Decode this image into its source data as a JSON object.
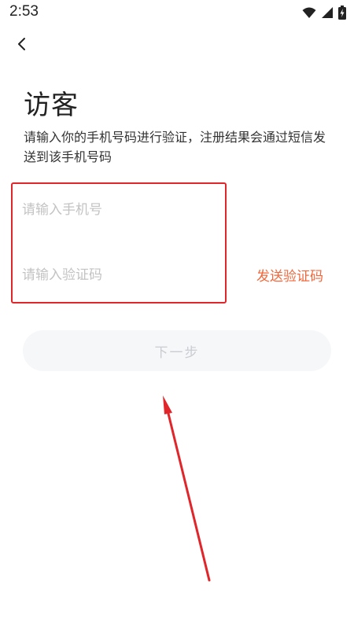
{
  "status_bar": {
    "time": "2:53",
    "icons": [
      "wifi-icon",
      "signal-icon",
      "battery-charging-icon"
    ]
  },
  "header": {
    "back_icon": "chevron-left-icon"
  },
  "main": {
    "title": "访客",
    "description": "请输入你的手机号码进行验证，注册结果会通过短信发送到该手机号码",
    "phone_input": {
      "value": "",
      "placeholder": "请输入手机号"
    },
    "code_input": {
      "value": "",
      "placeholder": "请输入验证码"
    },
    "send_code_label": "发送验证码",
    "next_label": "下一步"
  },
  "annotation": {
    "highlight_color": "#e0262b",
    "arrow_color": "#e0262b"
  },
  "colors": {
    "accent": "#f0683c",
    "button_bg": "#f6f7f9",
    "button_text_disabled": "#c9ccd1",
    "placeholder": "#c3c3c3"
  }
}
